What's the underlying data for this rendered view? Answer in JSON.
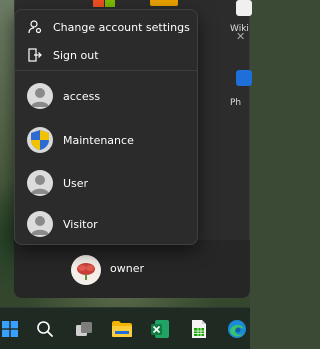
{
  "flyout": {
    "items": [
      {
        "label": "Change account settings",
        "icon": "settings-icon"
      },
      {
        "label": "Sign out",
        "icon": "sign-out-icon"
      }
    ],
    "accounts": [
      {
        "label": "access",
        "icon": "user-avatar-icon"
      },
      {
        "label": "Maintenance",
        "icon": "admin-shield-icon"
      },
      {
        "label": "User",
        "icon": "user-avatar-icon"
      },
      {
        "label": "Visitor",
        "icon": "user-avatar-icon"
      }
    ]
  },
  "start_menu": {
    "current_user": "owner"
  },
  "right_apps": {
    "first_label": "Wiki",
    "second_label": "Ph"
  },
  "taskbar": {
    "items": [
      "start",
      "search",
      "task-view",
      "file-explorer",
      "excel",
      "calc-spreadsheet",
      "edge"
    ]
  },
  "colors": {
    "flyout_bg": "#2b2b2b",
    "accent_blue": "#0078d4",
    "shield_yellow": "#f2c200"
  }
}
